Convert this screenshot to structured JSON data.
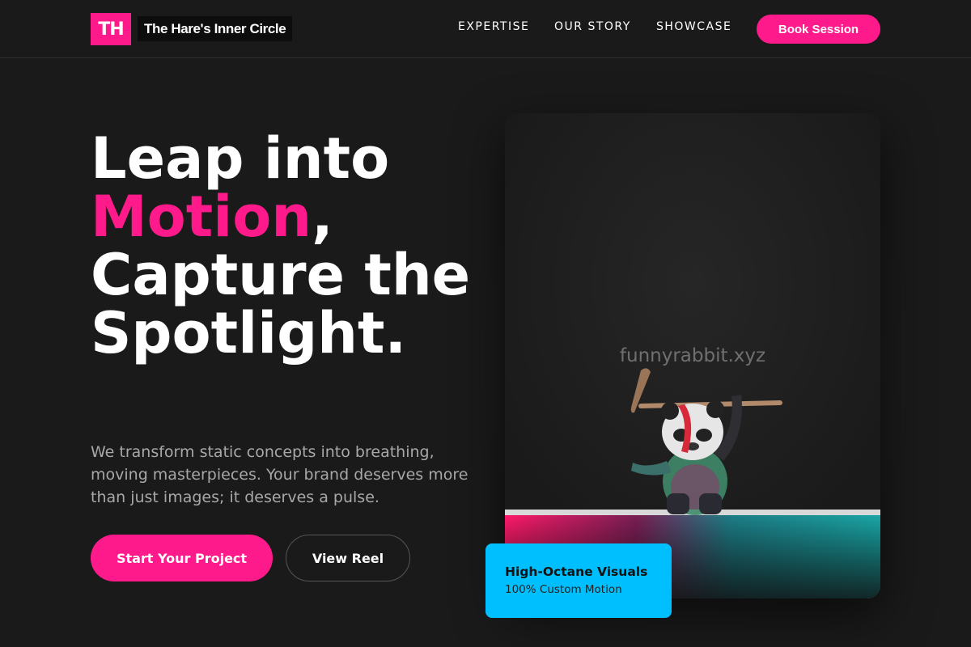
{
  "nav": {
    "logo_mark": "TH",
    "logo_name": "The Hare's Inner Circle",
    "links": [
      "EXPERTISE",
      "OUR STORY",
      "SHOWCASE"
    ],
    "cta": "Book Session"
  },
  "hero": {
    "headline_part1": "Leap into",
    "headline_accent": "Motion",
    "headline_comma": ",",
    "headline_part2": "Capture the Spotlight.",
    "subtext": "We transform static concepts into breathing, moving masterpieces. Your brand deserves more than just images; it deserves a pulse.",
    "primary_cta": "Start Your Project",
    "secondary_cta": "View Reel"
  },
  "image_card": {
    "watermark": "funnyrabbit.xyz",
    "badge_title": "High-Octane Visuals",
    "badge_subtitle": "100% Custom Motion"
  },
  "colors": {
    "background": "#1a1a1a",
    "accent_pink": "#ff1a8c",
    "accent_blue": "#00bfff"
  }
}
